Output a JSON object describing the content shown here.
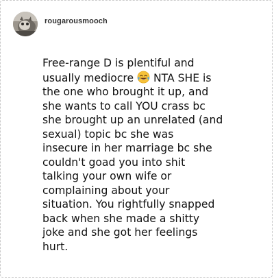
{
  "post": {
    "username": "rougarousmooch",
    "body_lines": [
      "Free-range D is plentiful and",
      "usually mediocre",
      " NTA SHE is",
      "the one who brought it up, and",
      "she wants to call YOU crass bc",
      "she brought up an unrelated (and",
      "sexual) topic bc she was",
      "insecure in her marriage bc she",
      "couldn't goad you into shit",
      "talking your own wife or",
      "complaining about your",
      "situation. You rightfully snapped",
      "back when she made a shitty",
      "joke and she got her feelings",
      "hurt."
    ],
    "emoji_icon": "tears-of-joy-emoji"
  },
  "colors": {
    "background": "#ffffff",
    "border": "#c9c9c9",
    "text": "#111111",
    "username": "#333333"
  }
}
